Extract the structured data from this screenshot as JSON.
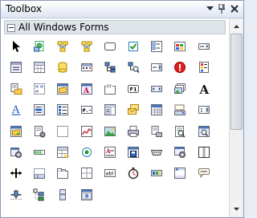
{
  "window": {
    "title": "Toolbox"
  },
  "group": {
    "label": "All Windows Forms",
    "expanded": true
  },
  "titlebar_buttons": [
    {
      "name": "dropdown-icon"
    },
    {
      "name": "pin-icon"
    },
    {
      "name": "close-icon"
    }
  ],
  "tools": [
    {
      "name": "pointer-tool",
      "glyph": "pointer"
    },
    {
      "name": "backgroundworker-tool",
      "glyph": "green-gear-doc"
    },
    {
      "name": "bindingnavigator-tool",
      "glyph": "net-yellow"
    },
    {
      "name": "bindingsource-tool",
      "glyph": "net-yellow"
    },
    {
      "name": "button-tool",
      "glyph": "ab",
      "text": "ab"
    },
    {
      "name": "checkbox-tool",
      "glyph": "check"
    },
    {
      "name": "checkedlistbox-tool",
      "glyph": "list-check"
    },
    {
      "name": "colordialog-tool",
      "glyph": "palette"
    },
    {
      "name": "combobox-tool",
      "glyph": "combo"
    },
    {
      "name": "contextmenustrip-tool",
      "glyph": "menu"
    },
    {
      "name": "datagridview-tool",
      "glyph": "grid-db"
    },
    {
      "name": "dataset-tool",
      "glyph": "db"
    },
    {
      "name": "datetimepicker-tool",
      "glyph": "calendar"
    },
    {
      "name": "directoryentry-tool",
      "glyph": "tree-blue"
    },
    {
      "name": "directorysearcher-tool",
      "glyph": "tree-mag"
    },
    {
      "name": "domainupdown-tool",
      "glyph": "updown"
    },
    {
      "name": "errorprovider-tool",
      "glyph": "error"
    },
    {
      "name": "eventlog-tool",
      "glyph": "eventlog"
    },
    {
      "name": "filesystemwatcher-tool",
      "glyph": "folder-doc"
    },
    {
      "name": "flowlayoutpanel-tool",
      "glyph": "flow"
    },
    {
      "name": "folderbrowserdialog-tool",
      "glyph": "folder-dlg"
    },
    {
      "name": "fontdialog-tool",
      "glyph": "font-dlg"
    },
    {
      "name": "groupbox-tool",
      "glyph": "groupbox",
      "text": "XY"
    },
    {
      "name": "helpprovider-tool",
      "glyph": "f1",
      "text": "F1"
    },
    {
      "name": "hscrollbar-tool",
      "glyph": "hscroll"
    },
    {
      "name": "imagelist-tool",
      "glyph": "imagelist"
    },
    {
      "name": "label-tool",
      "glyph": "label",
      "text": "A"
    },
    {
      "name": "linklabel-tool",
      "glyph": "linklabel",
      "text": "A"
    },
    {
      "name": "listbox-tool",
      "glyph": "listbox"
    },
    {
      "name": "listview-tool",
      "glyph": "listview"
    },
    {
      "name": "maskedtextbox-tool",
      "glyph": "masked",
      "text": "#.-"
    },
    {
      "name": "menustrip-tool",
      "glyph": "menustrip"
    },
    {
      "name": "messagequeue-tool",
      "glyph": "envelopes"
    },
    {
      "name": "monthcalendar-tool",
      "glyph": "monthcal"
    },
    {
      "name": "notifyicon-tool",
      "glyph": "notify"
    },
    {
      "name": "numericupdown-tool",
      "glyph": "numeric"
    },
    {
      "name": "openfiledialog-tool",
      "glyph": "openfile"
    },
    {
      "name": "pagesetupdialog-tool",
      "glyph": "pagesetup"
    },
    {
      "name": "panel-tool",
      "glyph": "panel"
    },
    {
      "name": "performancecounter-tool",
      "glyph": "perf"
    },
    {
      "name": "picturebox-tool",
      "glyph": "picture"
    },
    {
      "name": "printdialog-tool",
      "glyph": "print"
    },
    {
      "name": "printdocument-tool",
      "glyph": "print-doc"
    },
    {
      "name": "printpreviewcontrol-tool",
      "glyph": "preview"
    },
    {
      "name": "printpreviewdialog-tool",
      "glyph": "preview-dlg"
    },
    {
      "name": "process-tool",
      "glyph": "process"
    },
    {
      "name": "progressbar-tool",
      "glyph": "progress"
    },
    {
      "name": "propertygrid-tool",
      "glyph": "propgrid"
    },
    {
      "name": "radiobutton-tool",
      "glyph": "radio"
    },
    {
      "name": "richtextbox-tool",
      "glyph": "richtext"
    },
    {
      "name": "savefiledialog-tool",
      "glyph": "savefile"
    },
    {
      "name": "serialport-tool",
      "glyph": "serial"
    },
    {
      "name": "servicecontroller-tool",
      "glyph": "service"
    },
    {
      "name": "splitcontainer-tool",
      "glyph": "split"
    },
    {
      "name": "splitter-tool",
      "glyph": "splitter"
    },
    {
      "name": "statusstrip-tool",
      "glyph": "statusstrip"
    },
    {
      "name": "tabcontrol-tool",
      "glyph": "tabctrl"
    },
    {
      "name": "tablelayoutpanel-tool",
      "glyph": "tablelayout"
    },
    {
      "name": "textbox-tool",
      "glyph": "textbox",
      "text": "abl"
    },
    {
      "name": "timer-tool",
      "glyph": "timer"
    },
    {
      "name": "toolstrip-tool",
      "glyph": "toolstrip"
    },
    {
      "name": "toolstripcontainer-tool",
      "glyph": "tscontainer"
    },
    {
      "name": "tooltip-tool",
      "glyph": "tooltip"
    },
    {
      "name": "trackbar-tool",
      "glyph": "trackbar"
    },
    {
      "name": "treeview-tool",
      "glyph": "treeview"
    },
    {
      "name": "vscrollbar-tool",
      "glyph": "vscroll"
    },
    {
      "name": "webbrowser-tool",
      "glyph": "web"
    }
  ],
  "colors": {
    "titlebar": "#dfe5f1",
    "group_header": "#dfe3ea",
    "border": "#8d9bb6"
  }
}
